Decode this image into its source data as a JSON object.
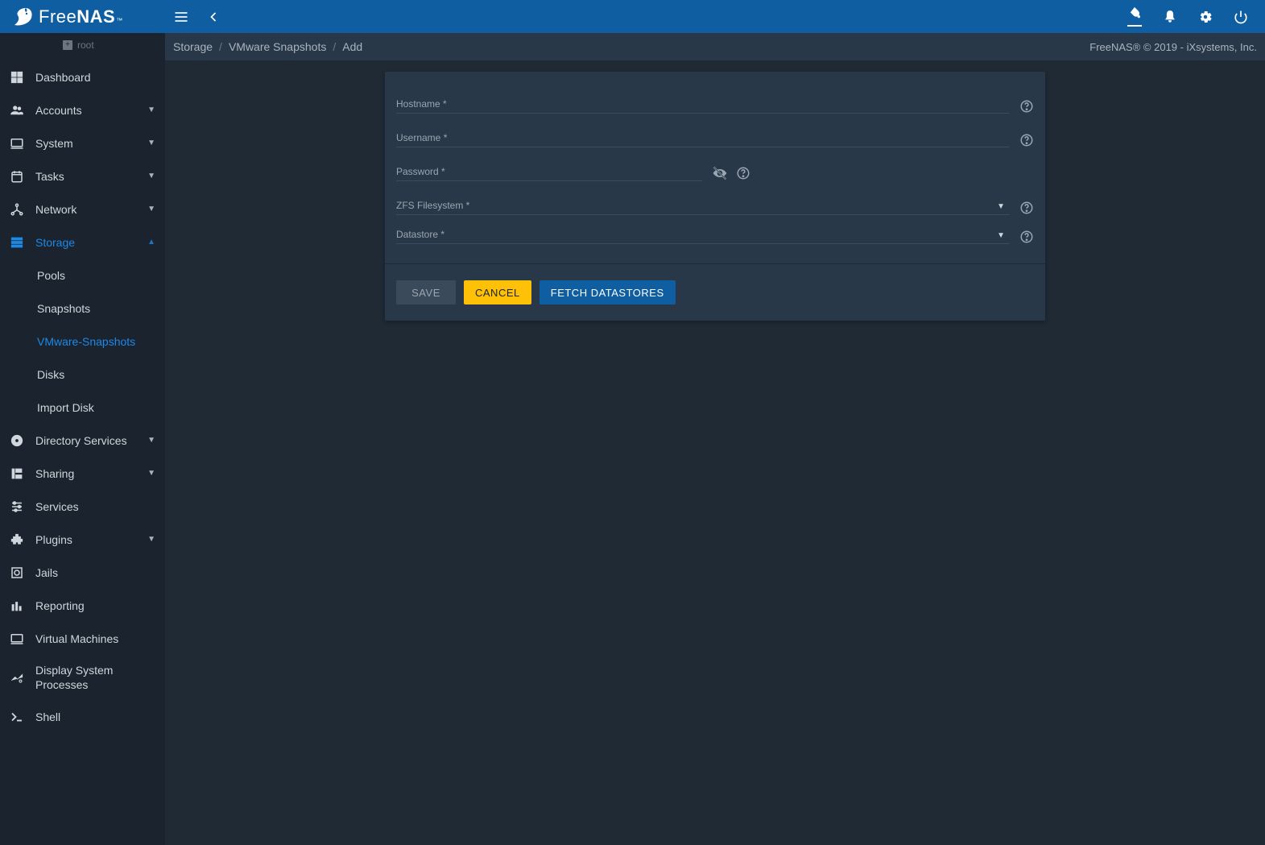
{
  "brand": {
    "free": "Free",
    "nas": "NAS",
    "tm": "™"
  },
  "subroot": "root",
  "sidebar": {
    "items": [
      {
        "label": "Dashboard",
        "expand": null
      },
      {
        "label": "Accounts",
        "expand": "down"
      },
      {
        "label": "System",
        "expand": "down"
      },
      {
        "label": "Tasks",
        "expand": "down"
      },
      {
        "label": "Network",
        "expand": "down"
      },
      {
        "label": "Storage",
        "expand": "up",
        "active": true,
        "children": [
          {
            "label": "Pools"
          },
          {
            "label": "Snapshots"
          },
          {
            "label": "VMware-Snapshots",
            "active": true
          },
          {
            "label": "Disks"
          },
          {
            "label": "Import Disk"
          }
        ]
      },
      {
        "label": "Directory Services",
        "expand": "down"
      },
      {
        "label": "Sharing",
        "expand": "down"
      },
      {
        "label": "Services",
        "expand": null
      },
      {
        "label": "Plugins",
        "expand": "down"
      },
      {
        "label": "Jails",
        "expand": null
      },
      {
        "label": "Reporting",
        "expand": null
      },
      {
        "label": "Virtual Machines",
        "expand": null
      },
      {
        "label": "Display System Processes",
        "expand": null,
        "multi": true
      },
      {
        "label": "Shell",
        "expand": null
      }
    ]
  },
  "breadcrumbs": [
    "Storage",
    "VMware Snapshots",
    "Add"
  ],
  "copyright": "FreeNAS® © 2019 - iXsystems, Inc.",
  "form": {
    "hostname": "Hostname *",
    "username": "Username *",
    "password": "Password *",
    "zfs": "ZFS Filesystem *",
    "datastore": "Datastore *"
  },
  "buttons": {
    "save": "SAVE",
    "cancel": "CANCEL",
    "fetch": "FETCH DATASTORES"
  }
}
